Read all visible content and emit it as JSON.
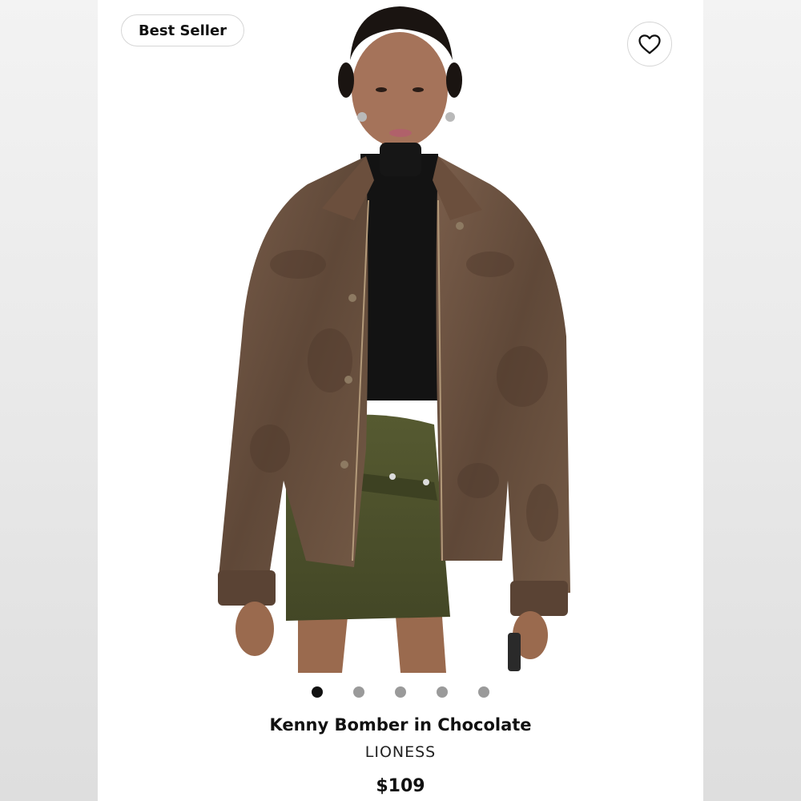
{
  "product": {
    "badge": "Best Seller",
    "title": "Kenny Bomber in Chocolate",
    "brand": "LIONESS",
    "price": "$109",
    "image_alt": "Model wearing brown distressed leather bomber jacket with black turtleneck and olive mini skirt"
  },
  "icons": {
    "favorite": "heart-icon"
  },
  "carousel": {
    "count": 5,
    "active_index": 0
  },
  "colors": {
    "jacket": "#6e5443",
    "skirt": "#4c4f2a",
    "top": "#131313",
    "active_dot": "#111111",
    "inactive_dot": "#9a9a9a"
  }
}
